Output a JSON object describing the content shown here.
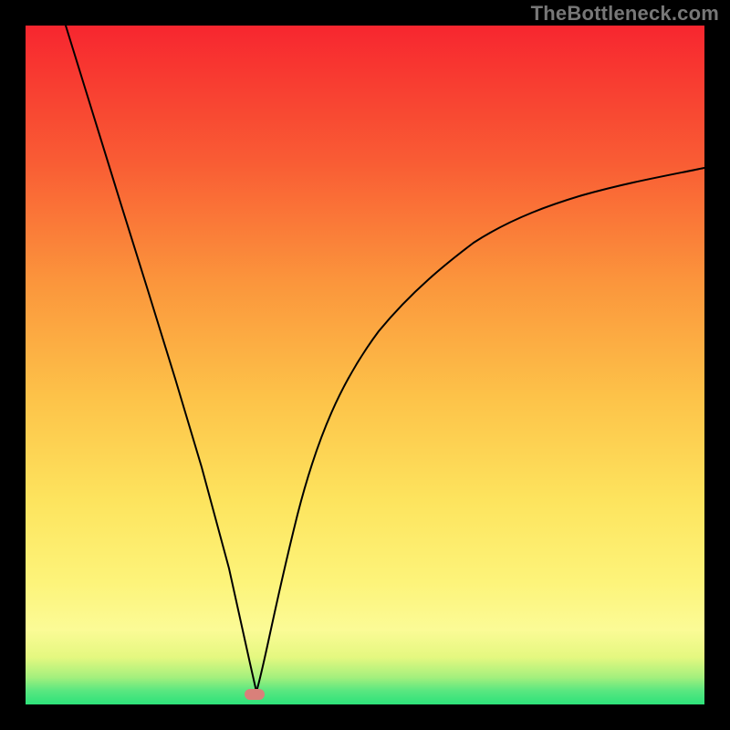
{
  "watermark": "TheBottleneck.com",
  "chart_data": {
    "type": "line",
    "title": "",
    "xlabel": "",
    "ylabel": "",
    "xlim": [
      0,
      100
    ],
    "ylim": [
      0,
      100
    ],
    "grid": false,
    "legend": false,
    "background": "rainbow-green-to-red",
    "marker": {
      "x": 34,
      "y": 2
    },
    "series": [
      {
        "name": "left-branch",
        "x": [
          6,
          10,
          14,
          18,
          22,
          26,
          30,
          33,
          34
        ],
        "y": [
          100,
          87,
          74,
          61,
          48,
          35,
          20,
          6,
          2
        ]
      },
      {
        "name": "right-branch",
        "x": [
          34,
          36,
          40,
          46,
          52,
          58,
          66,
          74,
          82,
          90,
          100
        ],
        "y": [
          2,
          10,
          28,
          44,
          55,
          62,
          68,
          72,
          75,
          77,
          79
        ]
      }
    ],
    "annotations": []
  }
}
